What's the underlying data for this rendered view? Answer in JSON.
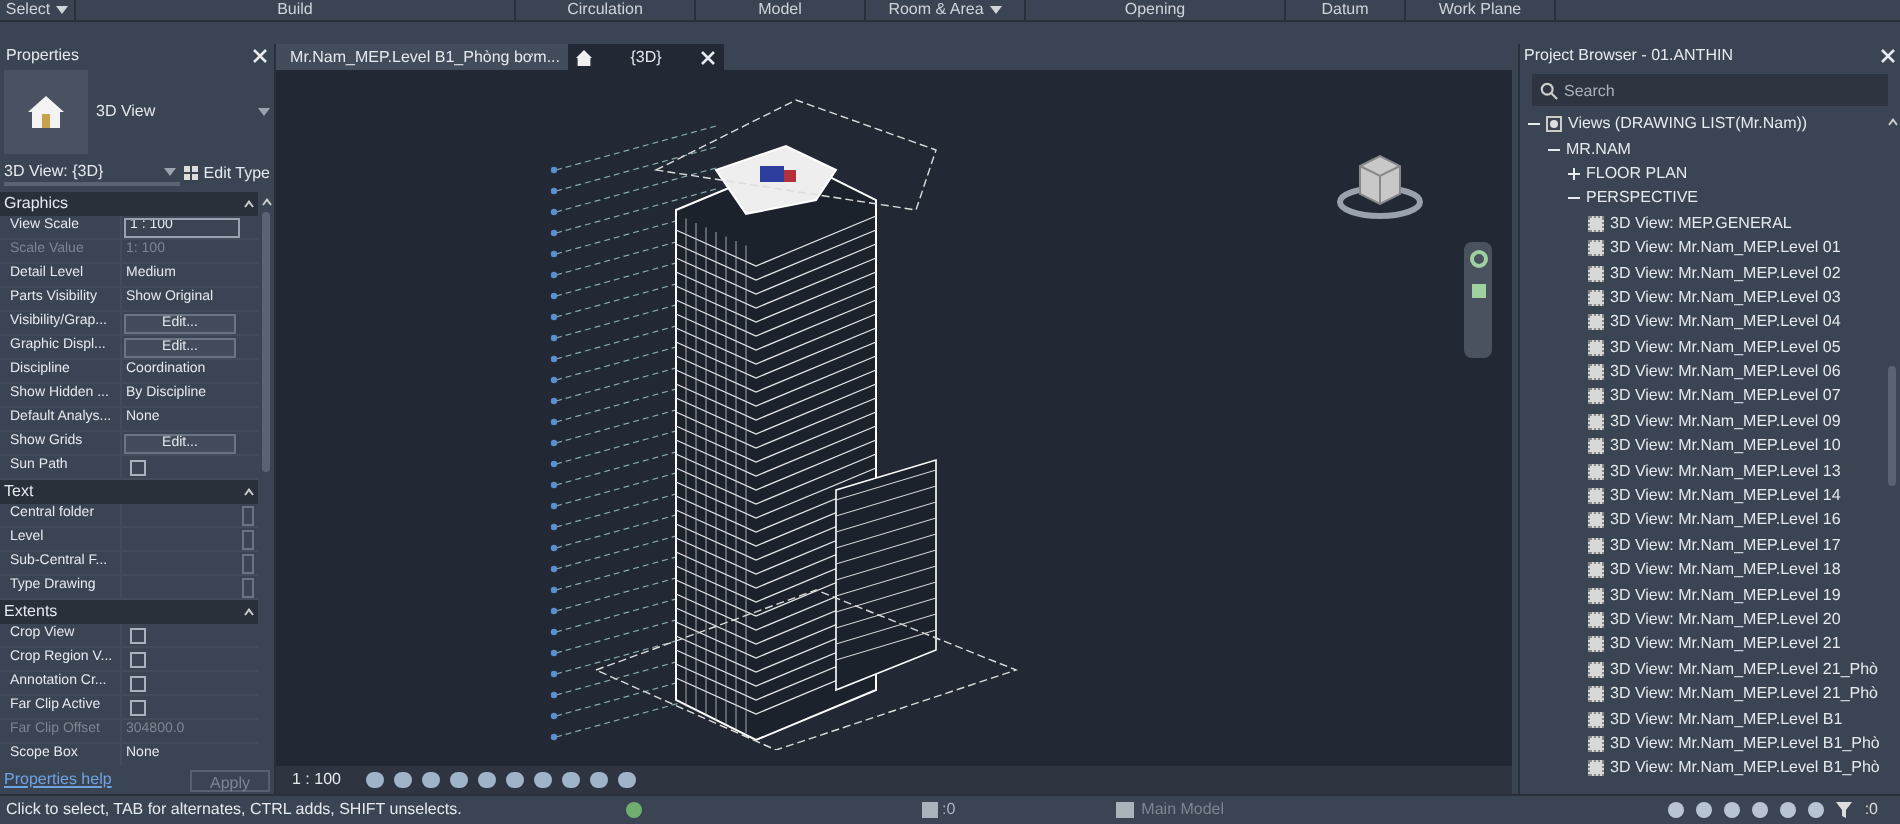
{
  "ribbon": {
    "tabs": [
      {
        "label": "Select",
        "has_menu": true
      },
      {
        "label": "Build",
        "has_menu": false
      },
      {
        "label": "Circulation",
        "has_menu": false
      },
      {
        "label": "Model",
        "has_menu": false
      },
      {
        "label": "Room & Area",
        "has_menu": true
      },
      {
        "label": "Opening",
        "has_menu": false
      },
      {
        "label": "Datum",
        "has_menu": false
      },
      {
        "label": "Work Plane",
        "has_menu": false
      }
    ]
  },
  "properties": {
    "title": "Properties",
    "type_name": "3D View",
    "instance_selector": "3D View: {3D}",
    "edit_type": "Edit Type",
    "sections": [
      {
        "title": "Graphics",
        "rows": [
          {
            "label": "View Scale",
            "kind": "input",
            "value": "1 : 100"
          },
          {
            "label": "Scale Value",
            "kind": "disabled",
            "value": "1: 100"
          },
          {
            "label": "Detail Level",
            "kind": "text",
            "value": "Medium"
          },
          {
            "label": "Parts Visibility",
            "kind": "text",
            "value": "Show Original"
          },
          {
            "label": "Visibility/Grap...",
            "kind": "button",
            "value": "Edit..."
          },
          {
            "label": "Graphic Displ...",
            "kind": "button",
            "value": "Edit..."
          },
          {
            "label": "Discipline",
            "kind": "text",
            "value": "Coordination"
          },
          {
            "label": "Show Hidden ...",
            "kind": "text",
            "value": "By Discipline"
          },
          {
            "label": "Default Analys...",
            "kind": "text",
            "value": "None"
          },
          {
            "label": "Show Grids",
            "kind": "button",
            "value": "Edit..."
          },
          {
            "label": "Sun Path",
            "kind": "checkbox",
            "checked": false
          }
        ]
      },
      {
        "title": "Text",
        "rows": [
          {
            "label": "Central folder",
            "kind": "blank"
          },
          {
            "label": "Level",
            "kind": "blank"
          },
          {
            "label": "Sub-Central F...",
            "kind": "blank"
          },
          {
            "label": "Type Drawing",
            "kind": "blank"
          }
        ]
      },
      {
        "title": "Extents",
        "rows": [
          {
            "label": "Crop View",
            "kind": "checkbox",
            "checked": false
          },
          {
            "label": "Crop Region V...",
            "kind": "checkbox",
            "checked": false
          },
          {
            "label": "Annotation Cr...",
            "kind": "checkbox",
            "checked": false
          },
          {
            "label": "Far Clip Active",
            "kind": "checkbox",
            "checked": false
          },
          {
            "label": "Far Clip Offset",
            "kind": "disabled",
            "value": "304800.0"
          },
          {
            "label": "Scope Box",
            "kind": "text",
            "value": "None"
          }
        ]
      }
    ],
    "help_link": "Properties help",
    "apply": "Apply"
  },
  "view_tabs": [
    {
      "label": "Mr.Nam_MEP.Level B1_Phòng bơm...",
      "selected": false
    },
    {
      "label": "{3D}",
      "selected": true
    }
  ],
  "view_control_bar": {
    "scale": "1 : 100"
  },
  "project_browser": {
    "title": "Project Browser - 01.ANTHIN",
    "search": {
      "placeholder": "Search"
    },
    "tree": [
      {
        "label": "Views (DRAWING LIST(Mr.Nam))",
        "expanded": true,
        "kind": "views",
        "children": [
          {
            "label": "MR.NAM",
            "expanded": true,
            "children": [
              {
                "label": "FLOOR PLAN",
                "expanded": false
              },
              {
                "label": "PERSPECTIVE",
                "expanded": true,
                "children": [
                  {
                    "label": "3D View: MEP.GENERAL",
                    "kind": "view"
                  },
                  {
                    "label": "3D View: Mr.Nam_MEP.Level 01",
                    "kind": "view"
                  },
                  {
                    "label": "3D View: Mr.Nam_MEP.Level 02",
                    "kind": "view"
                  },
                  {
                    "label": "3D View: Mr.Nam_MEP.Level 03",
                    "kind": "view"
                  },
                  {
                    "label": "3D View: Mr.Nam_MEP.Level 04",
                    "kind": "view"
                  },
                  {
                    "label": "3D View: Mr.Nam_MEP.Level 05",
                    "kind": "view"
                  },
                  {
                    "label": "3D View: Mr.Nam_MEP.Level 06",
                    "kind": "view"
                  },
                  {
                    "label": "3D View: Mr.Nam_MEP.Level 07",
                    "kind": "view"
                  },
                  {
                    "label": "3D View: Mr.Nam_MEP.Level 09",
                    "kind": "view"
                  },
                  {
                    "label": "3D View: Mr.Nam_MEP.Level 10",
                    "kind": "view"
                  },
                  {
                    "label": "3D View: Mr.Nam_MEP.Level 13",
                    "kind": "view"
                  },
                  {
                    "label": "3D View: Mr.Nam_MEP.Level 14",
                    "kind": "view"
                  },
                  {
                    "label": "3D View: Mr.Nam_MEP.Level 16",
                    "kind": "view"
                  },
                  {
                    "label": "3D View: Mr.Nam_MEP.Level 17",
                    "kind": "view"
                  },
                  {
                    "label": "3D View: Mr.Nam_MEP.Level 18",
                    "kind": "view"
                  },
                  {
                    "label": "3D View: Mr.Nam_MEP.Level 19",
                    "kind": "view"
                  },
                  {
                    "label": "3D View: Mr.Nam_MEP.Level 20",
                    "kind": "view"
                  },
                  {
                    "label": "3D View: Mr.Nam_MEP.Level 21",
                    "kind": "view"
                  },
                  {
                    "label": "3D View: Mr.Nam_MEP.Level 21_Phò",
                    "kind": "view"
                  },
                  {
                    "label": "3D View: Mr.Nam_MEP.Level 21_Phò",
                    "kind": "view"
                  },
                  {
                    "label": "3D View: Mr.Nam_MEP.Level B1",
                    "kind": "view"
                  },
                  {
                    "label": "3D View: Mr.Nam_MEP.Level B1_Phò",
                    "kind": "view"
                  },
                  {
                    "label": "3D View: Mr.Nam_MEP.Level B1_Phò",
                    "kind": "view"
                  }
                ]
              }
            ]
          }
        ]
      }
    ]
  },
  "status_bar": {
    "message": "Click to select, TAB for alternates, CTRL adds, SHIFT unselects.",
    "editable_only": ":0",
    "workset": "Main Model",
    "filter_count": ":0"
  }
}
